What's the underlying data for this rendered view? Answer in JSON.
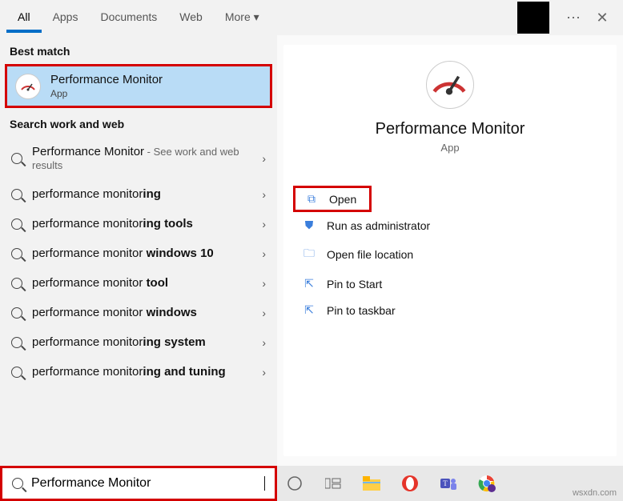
{
  "tabs": {
    "all": "All",
    "apps": "Apps",
    "documents": "Documents",
    "web": "Web",
    "more": "More"
  },
  "left": {
    "best_label": "Best match",
    "best": {
      "title": "Performance Monitor",
      "sub": "App"
    },
    "search_label": "Search work and web",
    "suggestions": [
      {
        "plain": "Performance Monitor",
        "bold": "",
        "extra": " - See work and web results"
      },
      {
        "plain": "performance monitor",
        "bold": "ing",
        "extra": ""
      },
      {
        "plain": "performance monitor",
        "bold": "ing tools",
        "extra": ""
      },
      {
        "plain": "performance monitor ",
        "bold": "windows 10",
        "extra": ""
      },
      {
        "plain": "performance monitor ",
        "bold": "tool",
        "extra": ""
      },
      {
        "plain": "performance monitor ",
        "bold": "windows",
        "extra": ""
      },
      {
        "plain": "performance monitor",
        "bold": "ing system",
        "extra": ""
      },
      {
        "plain": "performance monitor",
        "bold": "ing and tuning",
        "extra": ""
      }
    ]
  },
  "right": {
    "title": "Performance Monitor",
    "sub": "App",
    "actions": {
      "open": "Open",
      "admin": "Run as administrator",
      "loc": "Open file location",
      "pinstart": "Pin to Start",
      "pintask": "Pin to taskbar"
    }
  },
  "search": {
    "value": "Performance Monitor"
  },
  "watermark": "wsxdn.com"
}
